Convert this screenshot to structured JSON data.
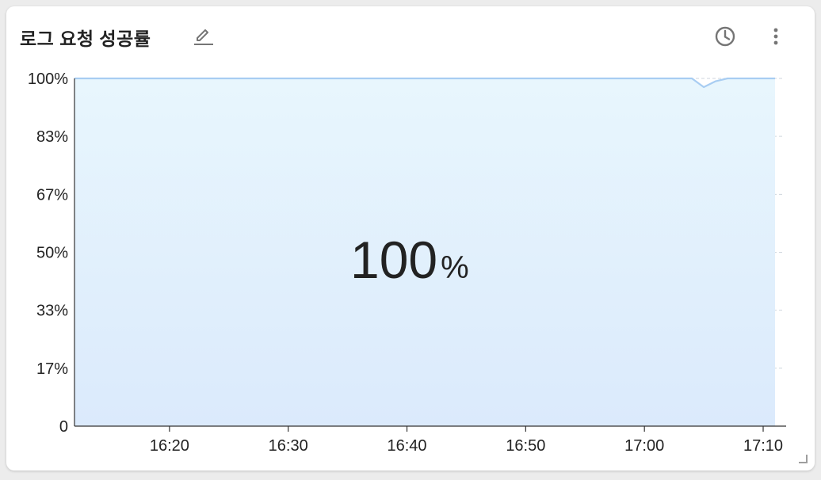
{
  "widget": {
    "title": "로그 요청 성공률",
    "icons": {
      "edit": "edit-pencil-icon",
      "history": "clock-icon",
      "menu": "more-vertical-icon",
      "resize": "resize-corner-icon"
    },
    "big_value": "100",
    "big_unit": "%"
  },
  "colors": {
    "line": "#a8cdf2",
    "fill_top": "#e8f6fd",
    "fill_bottom": "#dbeafc",
    "grid": "#cfd6dd",
    "axis": "#333333",
    "text": "#222222",
    "icon": "#757575"
  },
  "chart_data": {
    "type": "area",
    "title": "",
    "xlabel": "",
    "ylabel": "",
    "ylim": [
      0,
      100
    ],
    "xlim": [
      "16:12",
      "17:11"
    ],
    "grid": true,
    "legend": "none",
    "y_ticks": [
      {
        "value": 0,
        "label": "0"
      },
      {
        "value": 16.67,
        "label": "17%"
      },
      {
        "value": 33.33,
        "label": "33%"
      },
      {
        "value": 50,
        "label": "50%"
      },
      {
        "value": 66.67,
        "label": "67%"
      },
      {
        "value": 83.33,
        "label": "83%"
      },
      {
        "value": 100,
        "label": "100%"
      }
    ],
    "x_ticks": [
      {
        "value": "16:20",
        "label": "16:20"
      },
      {
        "value": "16:30",
        "label": "16:30"
      },
      {
        "value": "16:40",
        "label": "16:40"
      },
      {
        "value": "16:50",
        "label": "16:50"
      },
      {
        "value": "17:00",
        "label": "17:00"
      },
      {
        "value": "17:10",
        "label": "17:10"
      }
    ],
    "series": [
      {
        "x": [
          "16:12",
          "16:20",
          "16:30",
          "16:40",
          "16:50",
          "17:00",
          "17:04",
          "17:05",
          "17:06",
          "17:07",
          "17:10",
          "17:11"
        ],
        "y": [
          100,
          100,
          100,
          100,
          100,
          100,
          100,
          97.5,
          99.2,
          100,
          100,
          100
        ]
      }
    ]
  }
}
